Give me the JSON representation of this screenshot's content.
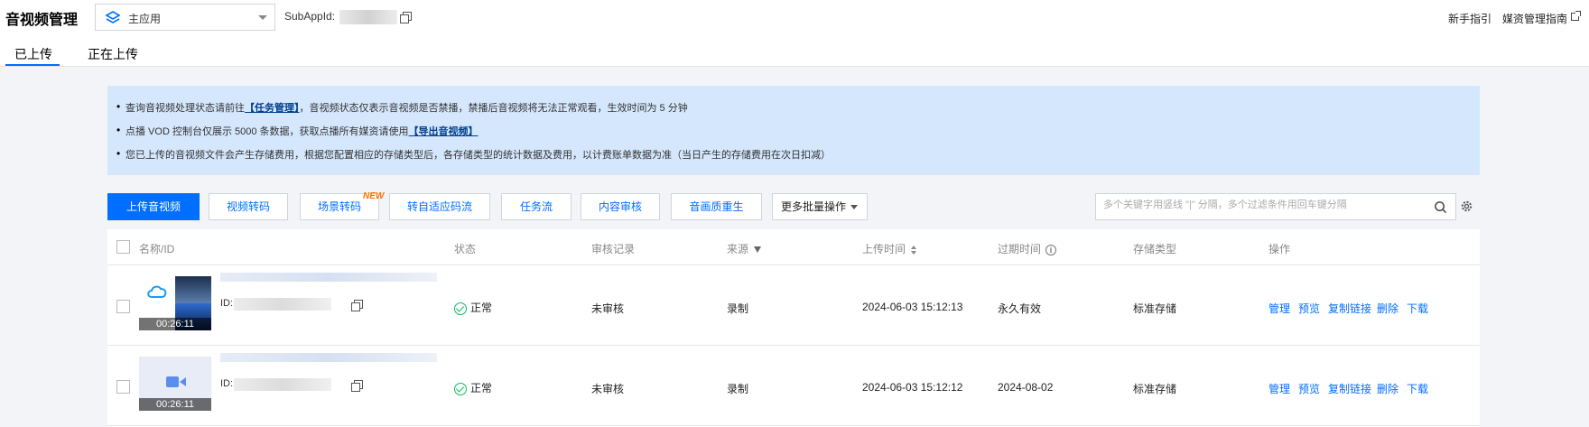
{
  "header": {
    "title": "音视频管理",
    "app_select": "主应用",
    "subappid_label": "SubAppId:",
    "guide_link": "新手指引",
    "docs_link": "媒资管理指南"
  },
  "tabs": {
    "uploaded": "已上传",
    "uploading": "正在上传"
  },
  "notice": {
    "line1_pre": "查询音视频处理状态请前往",
    "line1_link": "【任务管理】",
    "line1_post": "，音视频状态仅表示音视频是否禁播，禁播后音视频将无法正常观看，生效时间为 5 分钟",
    "line2_pre": "点播 VOD 控制台仅展示 5000 条数据，获取点播所有媒资请使用",
    "line2_link": "【导出音视频】",
    "line3": "您已上传的音视频文件会产生存储费用，根据您配置相应的存储类型后，各存储类型的统计数据及费用，以计费账单数据为准（当日产生的存储费用在次日扣减）"
  },
  "toolbar": {
    "upload": "上传音视频",
    "transcode": "视频转码",
    "scene_transcode": "场景转码",
    "new_badge": "NEW",
    "adaptive": "转自适应码流",
    "workflow": "任务流",
    "moderation": "内容审核",
    "remaster": "音画质重生",
    "more": "更多批量操作",
    "search_placeholder": "多个关键字用竖线 \"|\" 分隔，多个过滤条件用回车键分隔"
  },
  "table": {
    "columns": {
      "name": "名称/ID",
      "status": "状态",
      "review": "审核记录",
      "source": "来源",
      "upload_time": "上传时间",
      "expire_time": "过期时间",
      "storage": "存储类型",
      "actions": "操作"
    },
    "id_prefix": "ID:1",
    "rows": [
      {
        "duration": "00:26:11",
        "status": "正常",
        "review": "未审核",
        "source": "录制",
        "upload_time": "2024-06-03 15:12:13",
        "expire_time": "永久有效",
        "storage": "标准存储"
      },
      {
        "duration": "00:26:11",
        "status": "正常",
        "review": "未审核",
        "source": "录制",
        "upload_time": "2024-06-03 15:12:12",
        "expire_time": "2024-08-02",
        "storage": "标准存储"
      }
    ],
    "actions": {
      "manage": "管理",
      "preview": "预览",
      "copy_link": "复制链接",
      "delete": "删除",
      "download": "下载"
    }
  },
  "colors": {
    "accent": "#006eff",
    "notice_bg": "#d5e7fd",
    "success": "#0abf5b",
    "new_badge": "#ff7200"
  }
}
